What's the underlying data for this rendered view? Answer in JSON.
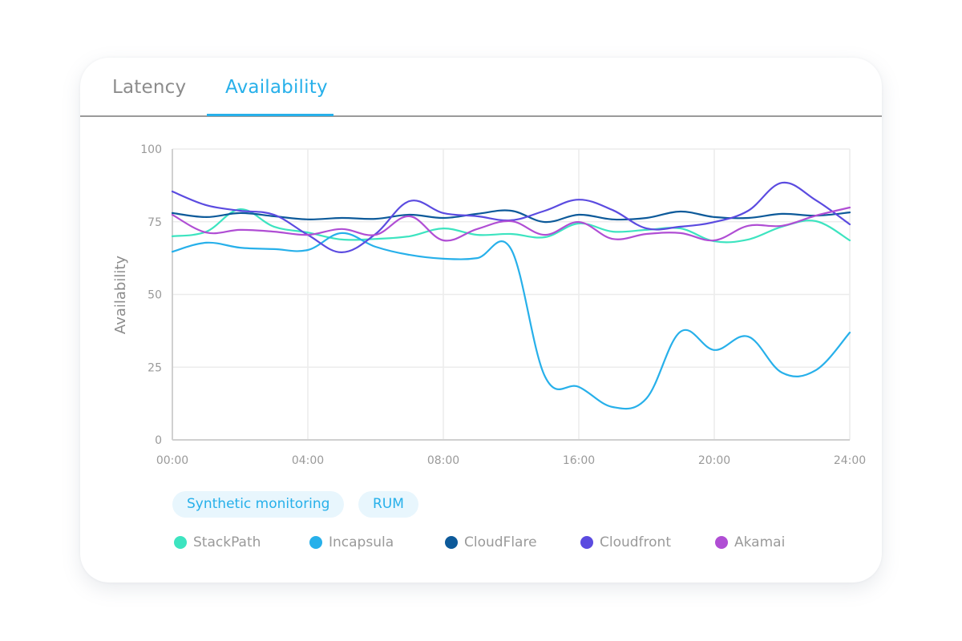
{
  "tabs": [
    {
      "label": "Latency",
      "active": false
    },
    {
      "label": "Availability",
      "active": true
    }
  ],
  "filters": [
    {
      "label": "Synthetic monitoring"
    },
    {
      "label": "RUM"
    }
  ],
  "colors": {
    "accent": "#27b0ea",
    "grid": "#ececec",
    "axis": "#d0d0d0",
    "tick_text": "#9a9a9a"
  },
  "chart_data": {
    "type": "line",
    "title": "",
    "xlabel": "",
    "ylabel": "Availability",
    "ylim": [
      0,
      100
    ],
    "yticks": [
      0,
      25,
      50,
      75,
      100
    ],
    "xtick_labels": [
      "00:00",
      "04:00",
      "08:00",
      "16:00",
      "20:00",
      "24:00"
    ],
    "x_note": "x values are tick-index positions (0 = 00:00 ... 5 = 24:00)",
    "xlim": [
      0,
      5
    ],
    "grid": true,
    "legend_position": "bottom-left",
    "x": [
      0,
      0.25,
      0.5,
      0.75,
      1,
      1.25,
      1.5,
      1.75,
      2,
      2.25,
      2.5,
      2.75,
      3,
      3.25,
      3.5,
      3.75,
      4,
      4.25,
      4.5,
      4.75,
      5
    ],
    "series": [
      {
        "name": "StackPath",
        "color": "#3de4c0",
        "values": [
          70,
          71.6,
          79.3,
          73.3,
          71.3,
          68.9,
          69.1,
          70,
          72.7,
          70.5,
          70.8,
          69.7,
          74.4,
          71.6,
          72.2,
          72.7,
          68.3,
          68.9,
          73.3,
          75.2,
          68.6
        ]
      },
      {
        "name": "Incapsula",
        "color": "#27b0ea",
        "values": [
          64.7,
          67.8,
          66.1,
          65.6,
          65.3,
          71.1,
          66.4,
          63.6,
          62.3,
          62.5,
          65.6,
          21.8,
          18.2,
          11.3,
          14.3,
          37.2,
          30.9,
          35.5,
          23.1,
          24,
          36.9
        ]
      },
      {
        "name": "CloudFlare",
        "color": "#0d5a9a",
        "values": [
          78,
          76.6,
          78,
          76.9,
          75.8,
          76.3,
          76,
          77.4,
          76.3,
          77.7,
          78.8,
          74.9,
          77.4,
          75.8,
          76.3,
          78.5,
          76.6,
          76.3,
          77.7,
          77.1,
          78.2
        ]
      },
      {
        "name": "Cloudfront",
        "color": "#5b4be0",
        "values": [
          85.4,
          80.7,
          78.8,
          77.4,
          70.5,
          64.5,
          70.8,
          82.1,
          78,
          76.9,
          75.5,
          78.8,
          82.6,
          79,
          72.7,
          73.3,
          74.9,
          78.8,
          88.4,
          82.4,
          74.1
        ]
      },
      {
        "name": "Akamai",
        "color": "#b04ed4",
        "values": [
          77.4,
          71.3,
          72.2,
          71.6,
          70.5,
          72.5,
          70.5,
          76.9,
          68.6,
          72.5,
          75.2,
          70.5,
          74.9,
          69.1,
          70.8,
          71.1,
          68.6,
          73.6,
          73.6,
          77.1,
          79.9
        ]
      }
    ]
  }
}
